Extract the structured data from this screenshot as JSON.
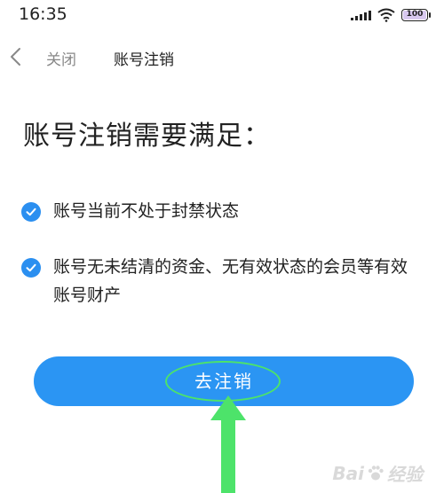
{
  "status_bar": {
    "time": "16:35",
    "battery_level": "100",
    "icons": [
      "signal-icon",
      "wifi-icon",
      "battery-icon"
    ]
  },
  "nav": {
    "back_icon": "chevron-left-icon",
    "close_label": "关闭",
    "title": "账号注销"
  },
  "main": {
    "heading": "账号注销需要满足：",
    "requirements": [
      {
        "text": "账号当前不处于封禁状态",
        "checked": true
      },
      {
        "text": "账号无未结清的资金、无有效状态的会员等有效账号财产",
        "checked": true
      }
    ],
    "action_button": "去注销"
  },
  "annotation": {
    "highlight_color": "#4de36a",
    "arrow": "up-arrow-icon"
  },
  "watermark": {
    "brand_left": "Bai",
    "brand_right": "经验"
  },
  "colors": {
    "accent": "#2b95f3",
    "check": "#2b8ff0"
  }
}
